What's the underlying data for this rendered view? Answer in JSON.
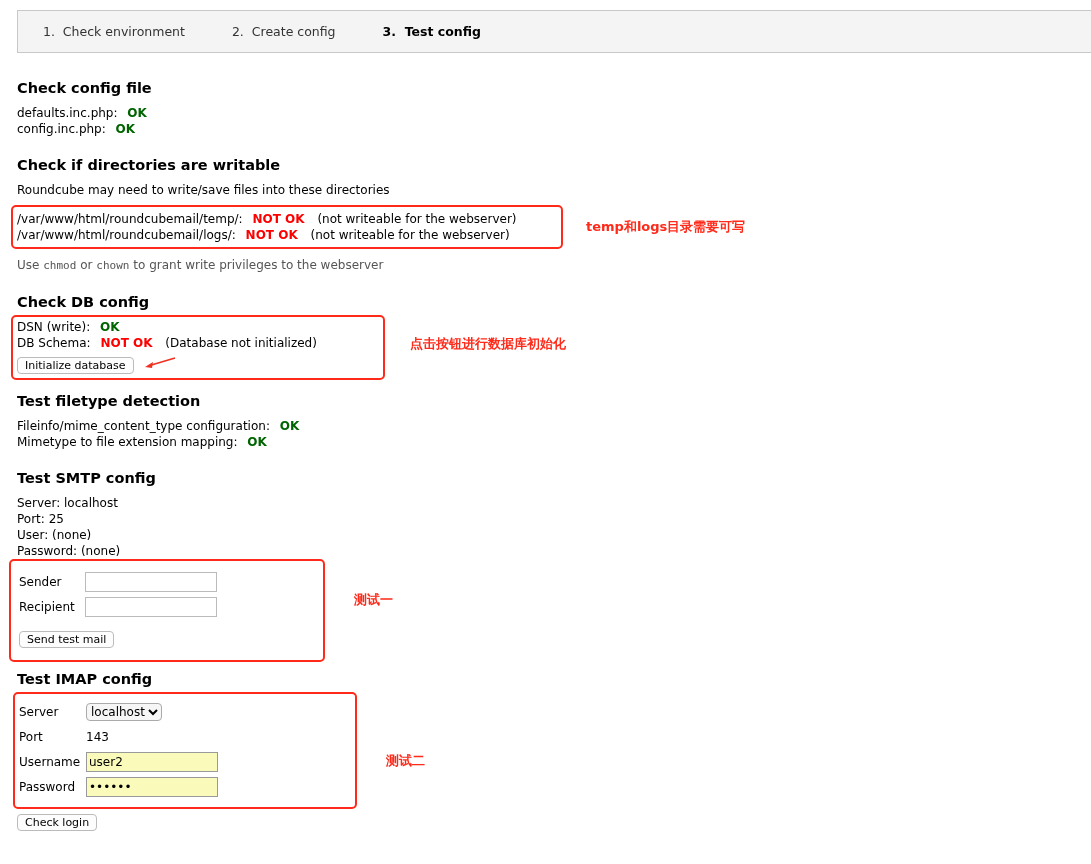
{
  "steps": [
    {
      "number": "1.",
      "label": "Check environment",
      "selected": false
    },
    {
      "number": "2.",
      "label": "Create config",
      "selected": false
    },
    {
      "number": "3.",
      "label": "Test config",
      "selected": true
    }
  ],
  "config_file": {
    "title": "Check config file",
    "checks": [
      {
        "label": "defaults.inc.php:",
        "status": "OK",
        "ok": true
      },
      {
        "label": "config.inc.php:",
        "status": "OK",
        "ok": true
      }
    ]
  },
  "directories": {
    "title": "Check if directories are writable",
    "intro": "Roundcube may need to write/save files into these directories",
    "checks": [
      {
        "label": "/var/www/html/roundcubemail/temp/:",
        "status": "NOT OK",
        "ok": false,
        "note": "(not writeable for the webserver)"
      },
      {
        "label": "/var/www/html/roundcubemail/logs/:",
        "status": "NOT OK",
        "ok": false,
        "note": "(not writeable for the webserver)"
      }
    ],
    "annotation": "temp和logs目录需要可写",
    "hint": [
      {
        "text": "Use",
        "code": false
      },
      {
        "text": "chmod",
        "code": true
      },
      {
        "text": "or",
        "code": false
      },
      {
        "text": "chown",
        "code": true
      },
      {
        "text": "to grant write privileges to the webserver",
        "code": false
      }
    ]
  },
  "db": {
    "title": "Check DB config",
    "checks": [
      {
        "label": "DSN (write):",
        "status": "OK",
        "ok": true
      },
      {
        "label": "DB Schema:",
        "status": "NOT OK",
        "ok": false,
        "note": "(Database not initialized)"
      }
    ],
    "button": "Initialize database",
    "annotation": "点击按钮进行数据库初始化"
  },
  "filetype": {
    "title": "Test filetype detection",
    "checks": [
      {
        "label": "Fileinfo/mime_content_type configuration:",
        "status": "OK",
        "ok": true
      },
      {
        "label": "Mimetype to file extension mapping:",
        "status": "OK",
        "ok": true
      }
    ]
  },
  "smtp": {
    "title": "Test SMTP config",
    "info": [
      "Server: localhost",
      "Port: 25",
      "User: (none)",
      "Password: (none)"
    ],
    "fields": [
      {
        "label": "Sender"
      },
      {
        "label": "Recipient"
      }
    ],
    "button": "Send test mail",
    "annotation": "测试一"
  },
  "imap": {
    "title": "Test IMAP config",
    "server_label": "Server",
    "server": "localhost",
    "port_label": "Port",
    "port": "143",
    "fields": [
      {
        "label": "Username",
        "value": "user2"
      },
      {
        "label": "Password",
        "value": "••••••"
      }
    ],
    "annotation": "测试二",
    "button": "Check login"
  }
}
